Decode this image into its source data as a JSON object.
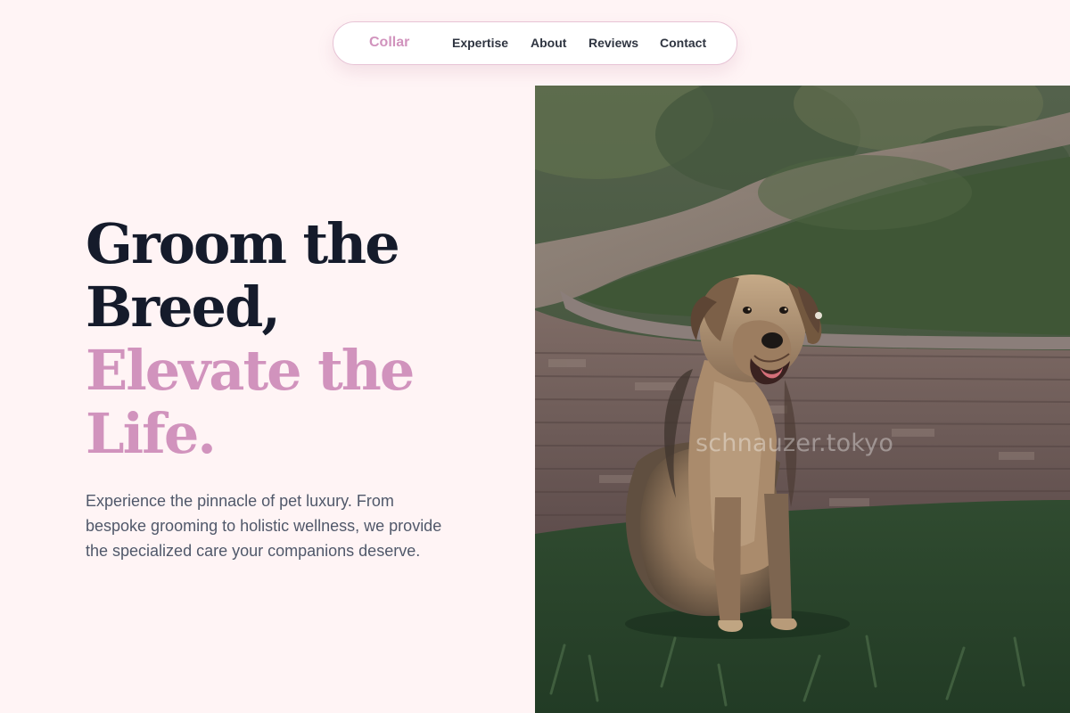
{
  "nav": {
    "brand": "Collar",
    "links": [
      "Expertise",
      "About",
      "Reviews",
      "Contact"
    ]
  },
  "hero": {
    "title_lines": [
      "Groom the",
      "Breed,"
    ],
    "accent_lines": [
      "Elevate the",
      "Life."
    ],
    "description": "Experience the pinnacle of pet luxury. From bespoke grooming to holistic wellness, we provide the specialized care your companions deserve."
  },
  "photo": {
    "watermark": "schnauzer.tokyo"
  },
  "colors": {
    "page_background": "#fff4f5",
    "accent": "#d193bd",
    "heading": "#151b2b",
    "body_text": "#50586a"
  }
}
